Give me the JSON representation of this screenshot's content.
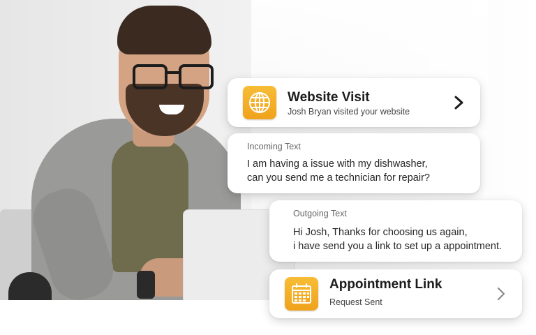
{
  "website_visit": {
    "title": "Website Visit",
    "subtitle": "Josh Bryan visited your website",
    "icon": "globe-icon"
  },
  "incoming": {
    "label": "Incoming Text",
    "line1": "I am having a issue with my dishwasher,",
    "line2": "can you send me a technician for repair?"
  },
  "outgoing": {
    "label": "Outgoing Text",
    "line1": "Hi Josh, Thanks for choosing us again,",
    "line2": "i have send you a link to set up a appointment."
  },
  "appointment": {
    "title": "Appointment Link",
    "subtitle": "Request Sent",
    "icon": "calendar-icon"
  },
  "colors": {
    "accent": "#f0a21c",
    "card_bg": "#ffffff",
    "title_text": "#1b1b1b"
  }
}
